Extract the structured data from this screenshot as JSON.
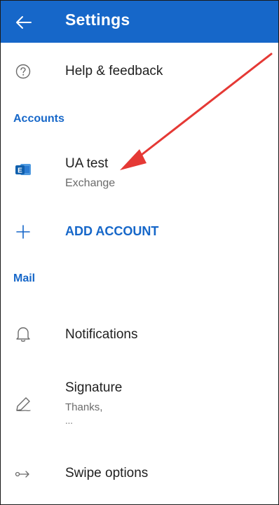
{
  "header": {
    "title": "Settings",
    "back_icon": "arrow-left-icon",
    "background": "#1667c9"
  },
  "items": {
    "help": {
      "label": "Help & feedback",
      "icon": "question-circle-icon"
    },
    "account": {
      "name": "UA test",
      "type": "Exchange",
      "icon": "exchange-icon"
    },
    "add_account": {
      "label": "ADD ACCOUNT",
      "icon": "plus-icon"
    },
    "notifications": {
      "label": "Notifications",
      "icon": "bell-icon"
    },
    "signature": {
      "label": "Signature",
      "preview_line1": "Thanks,",
      "preview_line2": "...",
      "icon": "signature-pen-icon"
    },
    "swipe": {
      "label": "Swipe options",
      "icon": "swipe-arrow-icon"
    }
  },
  "sections": {
    "accounts": "Accounts",
    "mail": "Mail"
  },
  "colors": {
    "accent": "#1667c9",
    "annotation_arrow": "#e53935"
  }
}
